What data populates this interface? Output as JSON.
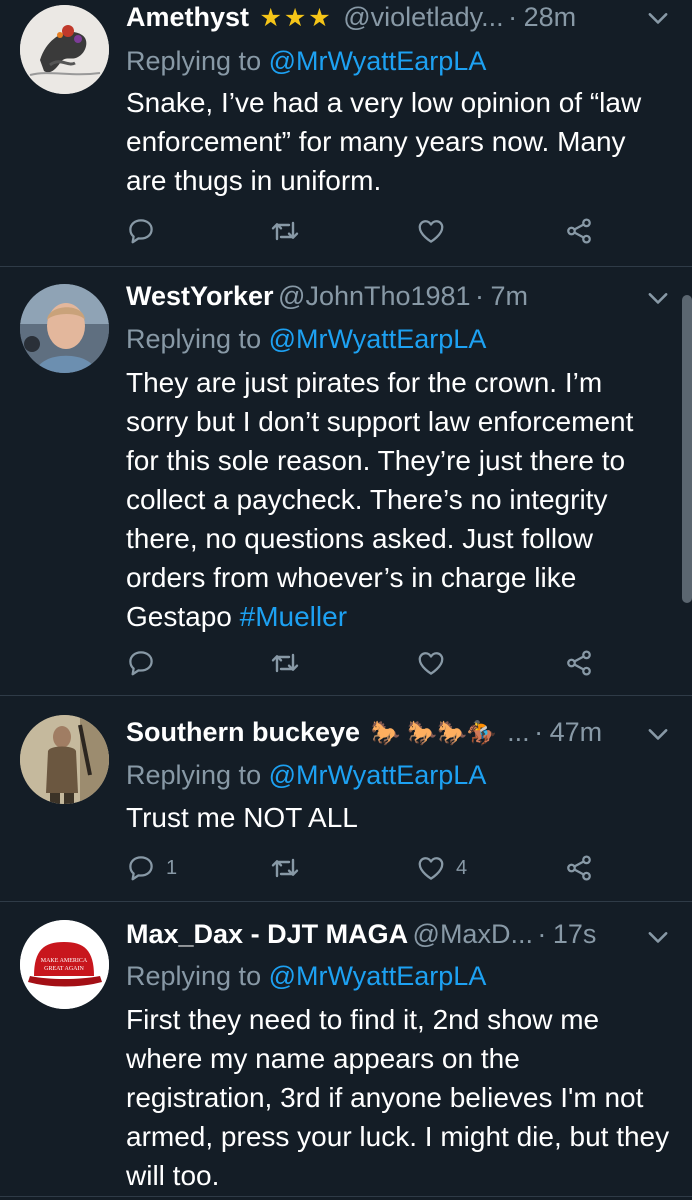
{
  "tweets": [
    {
      "name": "Amethyst",
      "stars": "★★★",
      "handle": "@violetlady...",
      "dot": "·",
      "time": "28m",
      "replying_label": "Replying to",
      "replying_mention": "@MrWyattEarpLA",
      "body": "Snake, I’ve had a very low opinion of “law enforcement” for many years now.  Many are thugs in uniform.",
      "reply_count": "",
      "like_count": ""
    },
    {
      "name": "WestYorker",
      "handle": "@JohnTho1981",
      "dot": "·",
      "time": "7m",
      "replying_label": "Replying to",
      "replying_mention": "@MrWyattEarpLA",
      "body": "They are just pirates for the crown. I’m sorry but I don’t support law enforcement for this sole reason. They’re just there to collect a paycheck. There’s no integrity there, no questions asked. Just follow orders from whoever’s in charge like Gestapo ",
      "hashtag": "#Mueller",
      "reply_count": "",
      "like_count": ""
    },
    {
      "name": "Southern buckeye",
      "horses": "🐎 🐎🐎🏇",
      "handle": "...",
      "dot": "·",
      "time": "47m",
      "replying_label": "Replying to",
      "replying_mention": "@MrWyattEarpLA",
      "body": "Trust me NOT ALL",
      "reply_count": "1",
      "like_count": "4"
    },
    {
      "name": "Max_Dax - DJT MAGA",
      "handle": "@MaxD...",
      "dot": "·",
      "time": "17s",
      "hat_text_1": "MAKE AMERICA",
      "hat_text_2": "GREAT AGAIN",
      "replying_label": "Replying to",
      "replying_mention": "@MrWyattEarpLA",
      "body": "First they need to find it, 2nd show me where my name appears on the registration, 3rd if anyone believes I'm not armed, press your luck. I might die, but they will too.",
      "reply_count": "",
      "like_count": ""
    }
  ],
  "colors": {
    "background": "#141d26",
    "divider": "#2f3b47",
    "muted": "#8899a6",
    "link": "#1da1f2",
    "text": "#ffffff",
    "star": "#f5c518"
  },
  "icons": [
    "reply-icon",
    "retweet-icon",
    "like-icon",
    "share-icon",
    "chevron-down-icon"
  ]
}
